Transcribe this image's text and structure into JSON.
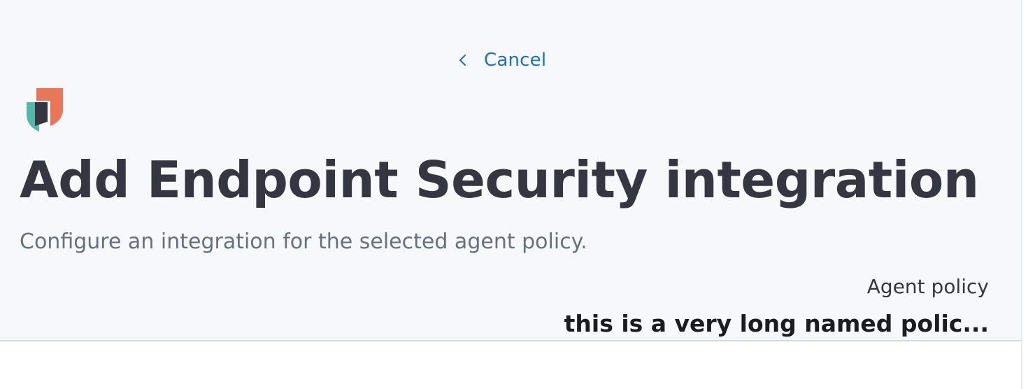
{
  "header": {
    "cancel_label": "Cancel",
    "title": "Add Endpoint Security integration",
    "subtitle": "Configure an integration for the selected agent policy.",
    "agent_policy": {
      "label": "Agent policy",
      "name": "this is a very long named polic..."
    }
  },
  "icons": {
    "back": "chevron-left-icon",
    "logo": "endpoint-security-logo"
  },
  "colors": {
    "link": "#1f6fbf",
    "title": "#343741",
    "subtitle": "#69707d",
    "logo_orange": "#e8775a",
    "logo_teal": "#54b7a8",
    "logo_dark": "#343741",
    "header_bg": "#f7f8fc"
  }
}
